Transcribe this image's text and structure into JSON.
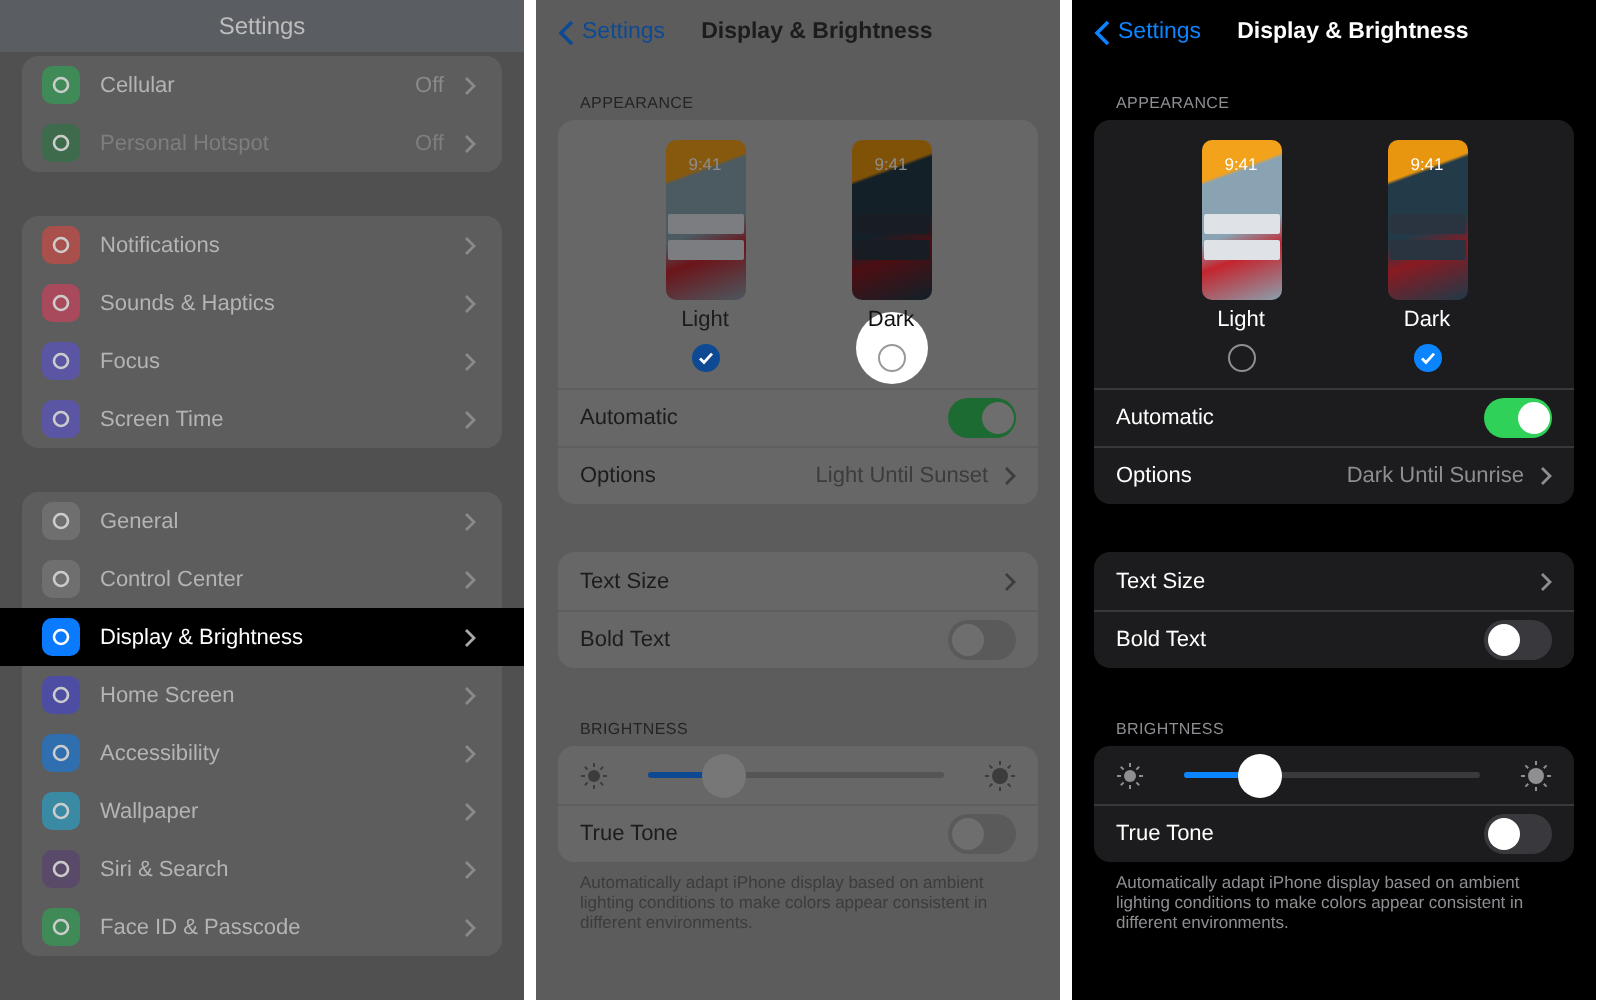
{
  "panels": [
    {
      "kind": "settings_list",
      "dark": true,
      "dimmed": true,
      "title": "Settings",
      "groups": [
        [
          {
            "label": "Cellular",
            "value": "Off",
            "color": "#3f8a57",
            "disabled": false,
            "selected": false
          },
          {
            "label": "Personal Hotspot",
            "value": "Off",
            "color": "#3d6b4b",
            "disabled": true,
            "selected": false
          }
        ],
        [
          {
            "label": "Notifications",
            "color": "#a9504c",
            "disabled": false,
            "selected": false
          },
          {
            "label": "Sounds & Haptics",
            "color": "#a84a5c",
            "disabled": false,
            "selected": false
          },
          {
            "label": "Focus",
            "color": "#5b56a3",
            "disabled": false,
            "selected": false
          },
          {
            "label": "Screen Time",
            "color": "#5b56a3",
            "disabled": false,
            "selected": false
          }
        ],
        [
          {
            "label": "General",
            "color": "#6f6f6f",
            "disabled": false,
            "selected": false
          },
          {
            "label": "Control Center",
            "color": "#6f6f6f",
            "disabled": false,
            "selected": false
          },
          {
            "label": "Display & Brightness",
            "color": "#0a7aff",
            "disabled": false,
            "selected": true
          },
          {
            "label": "Home Screen",
            "color": "#4d4ea3",
            "disabled": false,
            "selected": false
          },
          {
            "label": "Accessibility",
            "color": "#2f6fb0",
            "disabled": false,
            "selected": false
          },
          {
            "label": "Wallpaper",
            "color": "#3a8aa3",
            "disabled": false,
            "selected": false
          },
          {
            "label": "Siri & Search",
            "color": "#5a4a6a",
            "disabled": false,
            "selected": false
          },
          {
            "label": "Face ID & Passcode",
            "color": "#3f8a57",
            "disabled": false,
            "selected": false
          }
        ]
      ]
    },
    {
      "kind": "display",
      "dark": false,
      "dimmed": true,
      "back": "Settings",
      "title": "Display & Brightness",
      "appearance": {
        "header": "APPEARANCE",
        "options": [
          {
            "kind": "light",
            "time": "9:41",
            "label": "Light",
            "selected": true,
            "highlighted": false
          },
          {
            "kind": "dark",
            "time": "9:41",
            "label": "Dark",
            "selected": false,
            "highlighted": true
          }
        ]
      },
      "rows": [
        {
          "kind": "toggle",
          "label": "Automatic",
          "on": true
        },
        {
          "kind": "link",
          "label": "Options",
          "value": "Light Until Sunset"
        }
      ],
      "text_rows": [
        {
          "kind": "link",
          "label": "Text Size"
        },
        {
          "kind": "toggle",
          "label": "Bold Text",
          "on": false
        }
      ],
      "brightness": {
        "header": "BRIGHTNESS",
        "level": 0.26,
        "rows": [
          {
            "kind": "toggle",
            "label": "True Tone",
            "on": false
          }
        ],
        "footer": "Automatically adapt iPhone display based on ambient lighting conditions to make colors appear consistent in different environments."
      }
    },
    {
      "kind": "display",
      "dark": true,
      "dimmed": false,
      "back": "Settings",
      "title": "Display & Brightness",
      "appearance": {
        "header": "APPEARANCE",
        "options": [
          {
            "kind": "light",
            "time": "9:41",
            "label": "Light",
            "selected": false,
            "highlighted": false
          },
          {
            "kind": "dark",
            "time": "9:41",
            "label": "Dark",
            "selected": true,
            "highlighted": false
          }
        ]
      },
      "rows": [
        {
          "kind": "toggle",
          "label": "Automatic",
          "on": true
        },
        {
          "kind": "link",
          "label": "Options",
          "value": "Dark Until Sunrise"
        }
      ],
      "text_rows": [
        {
          "kind": "link",
          "label": "Text Size"
        },
        {
          "kind": "toggle",
          "label": "Bold Text",
          "on": false
        }
      ],
      "brightness": {
        "header": "BRIGHTNESS",
        "level": 0.26,
        "rows": [
          {
            "kind": "toggle",
            "label": "True Tone",
            "on": false
          }
        ],
        "footer": "Automatically adapt iPhone display based on ambient lighting conditions to make colors appear consistent in different environments."
      }
    }
  ]
}
